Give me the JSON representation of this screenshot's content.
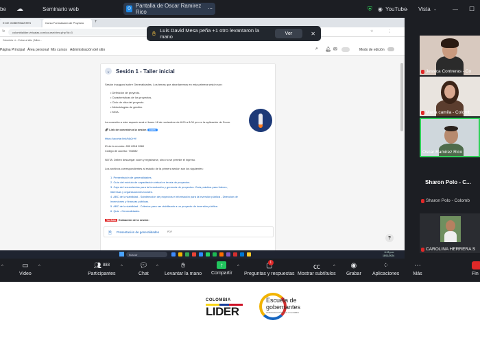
{
  "zoom_top": {
    "app_label": "be",
    "webinar_label": "Seminario web",
    "share_label": "Pantalla de Oscar Ramirez Rico",
    "share_dot": "O",
    "youtube_label": "YouTube",
    "view_label": "Vista"
  },
  "browser": {
    "tabs": [
      "E DE GOBERNANTES",
      "Curso Formulación de Proyecto"
    ],
    "url": "colombialider.virtualas.com/course/view.php?id=3",
    "bookmarks": "Colombia Lí...   Entrar al sitio | Milen..."
  },
  "moodle": {
    "nav": [
      "Página Principal",
      "Área personal",
      "Mis cursos",
      "Administración del sitio"
    ],
    "edit_mode": "Modo de edición"
  },
  "session": {
    "title": "Sesión 1 - Taller inicial",
    "intro": "Sesión inaugural sobre Generalidades. Los temas que abordaremos en esta primera sesión son:",
    "topics": [
      "Definición de proyecto.",
      "Características de los proyectos.",
      "Ciclo de vida del proyecto.",
      "Metodologías de gestión.",
      "MGA."
    ],
    "connection": "La conexión a este espacio será el lunes 18 de noviembre de 6:00 a 8:00 pm en la aplicación de Zoom.",
    "link_label": "Link de conexión a la sesión",
    "link_badge": "zoom",
    "link_url": "https://acortar.link/Mp2rHf",
    "meeting_id": "ID de la reunión: 890 6518 0560",
    "access_code": "Código de acceso: 746082",
    "note": "NOTA: Deben descargar zoom y registrarse, sino no se permite el ingreso.",
    "files_intro": "Los archivos correspondientes al estudio de la primera sesión son los siguientes:",
    "files": [
      "1. Presentación de generalidades.",
      "2. Guía del módulo de capacitación virtual en teoría de proyectos.",
      "3. Caja de herramientas para la formulación y gerencia de proyectos: Guía práctica para líderes,",
      "   lideresas y organizaciones locales.",
      "4. ABC de la viabilidad - Subdirección de proyectos e información para la inversión pública - Dirección de",
      "   inversiones y finanzas públicas.",
      "5. ABC de la viabilidad - Criterios para ser viabilizado a un proyecto de inversión pública.",
      "6. Quiz - Generalidades."
    ],
    "recording_label": "Grabación de la sesión:",
    "youtube_word": "YouTube",
    "pdf_item": "Presentación de generalidades",
    "pdf_tag": "PDF",
    "help": "?"
  },
  "taskbar": {
    "search": "Buscar",
    "time": "6:13 p.m.",
    "date": "18/11/2024"
  },
  "notification": {
    "text": "Luis David Mesa peña +1 otro levantaron la mano",
    "button": "Ver"
  },
  "participants": [
    {
      "name": "Jessica Contreras - Co"
    },
    {
      "name": "María camila - Colomb"
    },
    {
      "name": "Oscar Ramirez Rico"
    },
    {
      "name_big": "Sharon Polo - C...",
      "name": "Sharon Polo - Colomb"
    },
    {
      "name": "CAROLINA HERRERA S"
    }
  ],
  "toolbar": {
    "video": "Video",
    "participants": "Participantes",
    "participants_count": "888",
    "chat": "Chat",
    "raise_hand": "Levantar la mano",
    "share": "Compartir",
    "qa": "Preguntas y respuestas",
    "qa_count": "1",
    "subtitles": "Mostrar subtítulos",
    "record": "Grabar",
    "apps": "Aplicaciones",
    "more": "Más",
    "end": "Fin"
  },
  "logos": {
    "colombia_top": "COLOMBIA",
    "colombia_main": "LIDER",
    "escuela_1": "Escuela de",
    "escuela_2": "gobernantes",
    "escuela_3": "LIDERAZGO PÚBLICO COLOMBIA"
  }
}
